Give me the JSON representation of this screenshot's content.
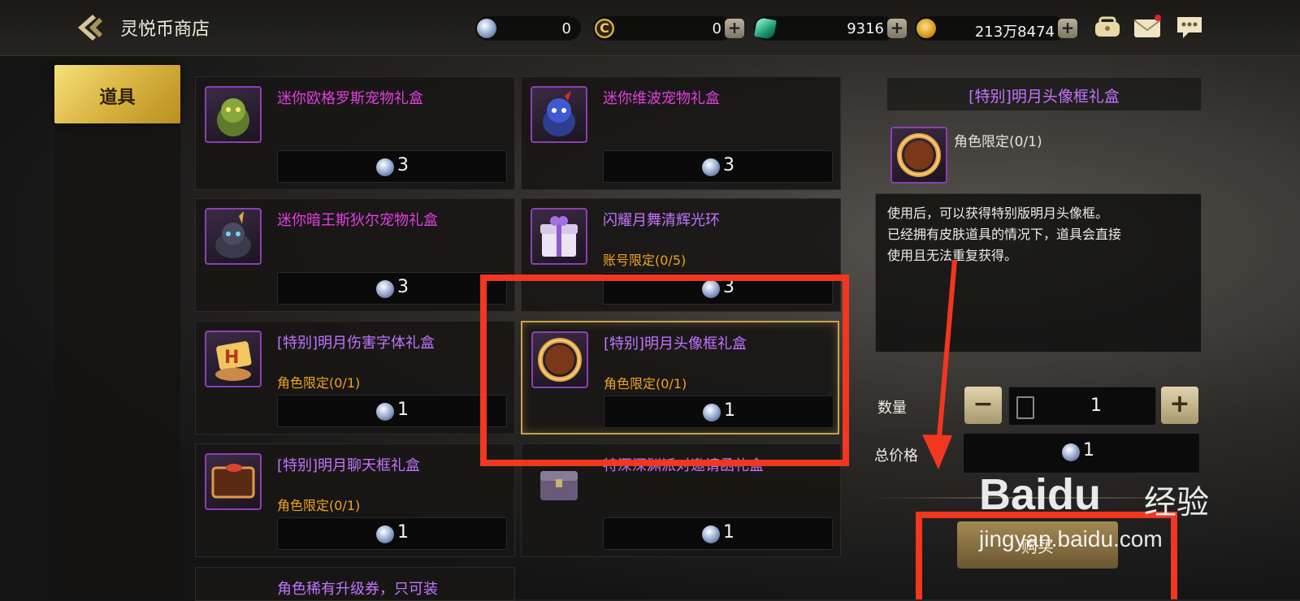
{
  "header": {
    "title": "灵悦币商店",
    "currencies": [
      {
        "name": "lingyue-coin",
        "value": "0"
      },
      {
        "name": "c-coin",
        "value": "0"
      },
      {
        "name": "green-gem",
        "value": "9316"
      },
      {
        "name": "gold-coin",
        "value": "213万8474"
      }
    ]
  },
  "sidebar": {
    "tabs": [
      {
        "label": "道具",
        "active": true
      }
    ]
  },
  "items": [
    {
      "name": "迷你欧格罗斯宠物礼盒",
      "limit": "",
      "price": "3",
      "color": "#e23ee0"
    },
    {
      "name": "迷你维波宠物礼盒",
      "limit": "",
      "price": "3",
      "color": "#e23ee0"
    },
    {
      "name": "迷你暗王斯狄尔宠物礼盒",
      "limit": "",
      "price": "3",
      "color": "#e23ee0"
    },
    {
      "name": "闪耀月舞清辉光环",
      "limit": "账号限定(0/5)",
      "price": "3",
      "color": "#c174ff"
    },
    {
      "name": "[特别]明月伤害字体礼盒",
      "limit": "角色限定(0/1)",
      "price": "1",
      "color": "#c174ff"
    },
    {
      "name": "[特别]明月头像框礼盒",
      "limit": "角色限定(0/1)",
      "price": "1",
      "color": "#c174ff"
    },
    {
      "name": "[特别]明月聊天框礼盒",
      "limit": "角色限定(0/1)",
      "price": "1",
      "color": "#c174ff"
    },
    {
      "name": "特深深渊派对邀请函礼盒",
      "limit": "",
      "price": "1",
      "color": "#c174ff"
    },
    {
      "name": "角色稀有升级券，只可装",
      "limit": "",
      "price": "",
      "color": "#c174ff"
    }
  ],
  "detail": {
    "title": "[特别]明月头像框礼盒",
    "limit": "角色限定(0/1)",
    "description": [
      "使用后，可以获得特别版明月头像框。",
      "已经拥有皮肤道具的情况下，道具会直接",
      "使用且无法重复获得。"
    ],
    "quantity_label": "数量",
    "quantity": "1",
    "total_label": "总价格",
    "total": "1",
    "buy_label": "购买"
  },
  "watermark": {
    "brand": "Baidu",
    "suffix": "经验",
    "url": "jingyan.baidu.com"
  },
  "colors": {
    "annotation_red": "#f2361f",
    "gold_accent": "#c9a34a",
    "purple_name": "#c174ff",
    "pink_name": "#e23ee0",
    "limit_orange": "#f0a31c"
  }
}
